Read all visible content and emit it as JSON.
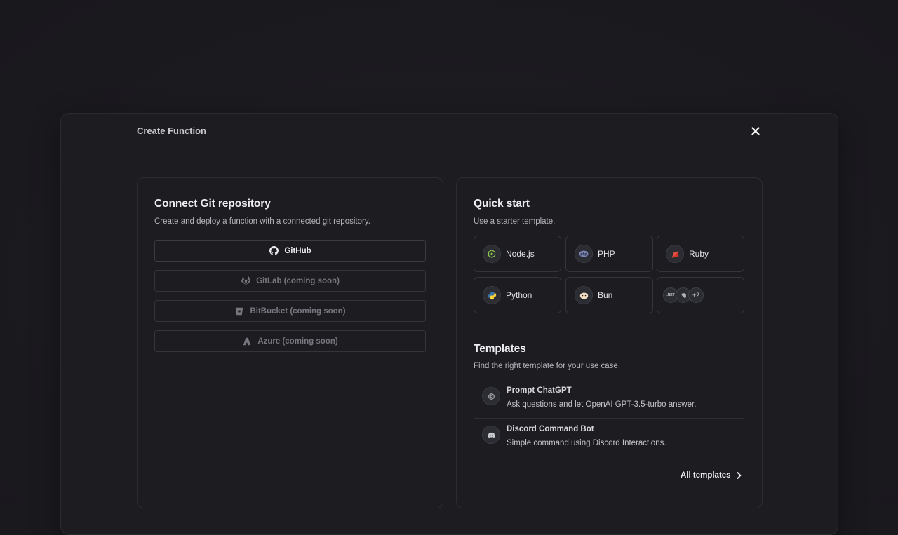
{
  "modal": {
    "title": "Create Function"
  },
  "git": {
    "title": "Connect Git repository",
    "subtitle": "Create and deploy a function with a connected git repository.",
    "providers": [
      {
        "label": "GitHub",
        "icon": "github-icon",
        "enabled": true
      },
      {
        "label": "GitLab (coming soon)",
        "icon": "gitlab-icon",
        "enabled": false
      },
      {
        "label": "BitBucket (coming soon)",
        "icon": "bitbucket-icon",
        "enabled": false
      },
      {
        "label": "Azure (coming soon)",
        "icon": "azure-icon",
        "enabled": false
      }
    ]
  },
  "quickstart": {
    "title": "Quick start",
    "subtitle": "Use a starter template.",
    "runtimes": [
      {
        "label": "Node.js",
        "icon": "nodejs-icon",
        "color": "#8cc84b"
      },
      {
        "label": "PHP",
        "icon": "php-icon",
        "color": "#7a86b8"
      },
      {
        "label": "Ruby",
        "icon": "ruby-icon",
        "color": "#d0342c"
      },
      {
        "label": "Python",
        "icon": "python-icon",
        "color": "#3776ab"
      },
      {
        "label": "Bun",
        "icon": "bun-icon",
        "color": "#f5e0c3"
      }
    ],
    "more": {
      "icons": [
        ".NET",
        "dart-icon"
      ],
      "count": "+2"
    }
  },
  "templates": {
    "title": "Templates",
    "subtitle": "Find the right template for your use case.",
    "items": [
      {
        "name": "Prompt ChatGPT",
        "description": "Ask questions and let OpenAI GPT-3.5-turbo answer.",
        "icon": "openai-icon"
      },
      {
        "name": "Discord Command Bot",
        "description": "Simple command using Discord Interactions.",
        "icon": "discord-icon"
      }
    ],
    "all_label": "All templates"
  }
}
